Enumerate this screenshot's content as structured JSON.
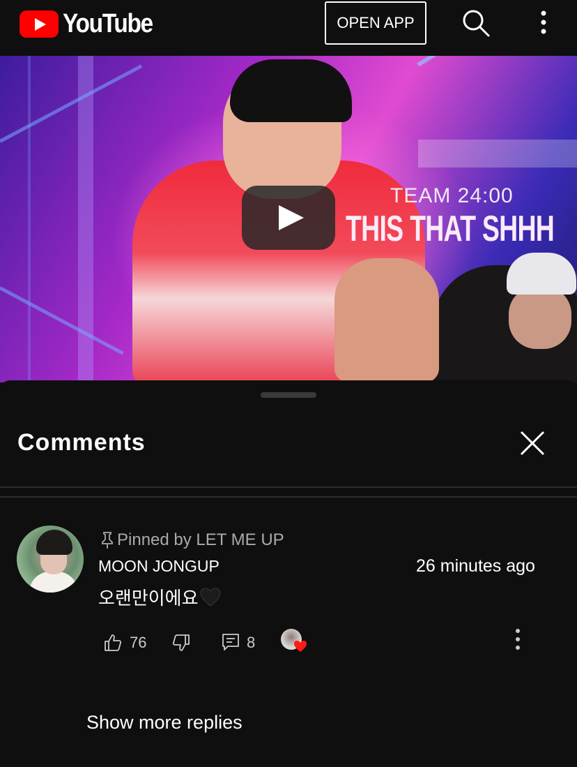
{
  "header": {
    "logo_text": "YouTube",
    "open_app_label": "OPEN APP",
    "icons": [
      "youtube-play-icon",
      "search-icon",
      "more-vertical-icon"
    ]
  },
  "video": {
    "overlay_line1": "TEAM 24:00",
    "overlay_line2": "THIS THAT SHHH",
    "play_icon": "play-icon"
  },
  "comments_panel": {
    "title": "Comments",
    "close_icon": "close-icon",
    "comment": {
      "pinned_label": "Pinned by LET ME UP",
      "author": "MOON JONGUP",
      "timestamp": "26 minutes ago",
      "text": "오랜만이에요",
      "emoji": "black-heart",
      "like_count": "76",
      "reply_count": "8"
    },
    "show_more_label": "Show more replies"
  },
  "colors": {
    "background": "#0f0f0f",
    "brand_red": "#ff0000",
    "divider": "#2c2c2c",
    "secondary_text": "#aaaaaa"
  }
}
